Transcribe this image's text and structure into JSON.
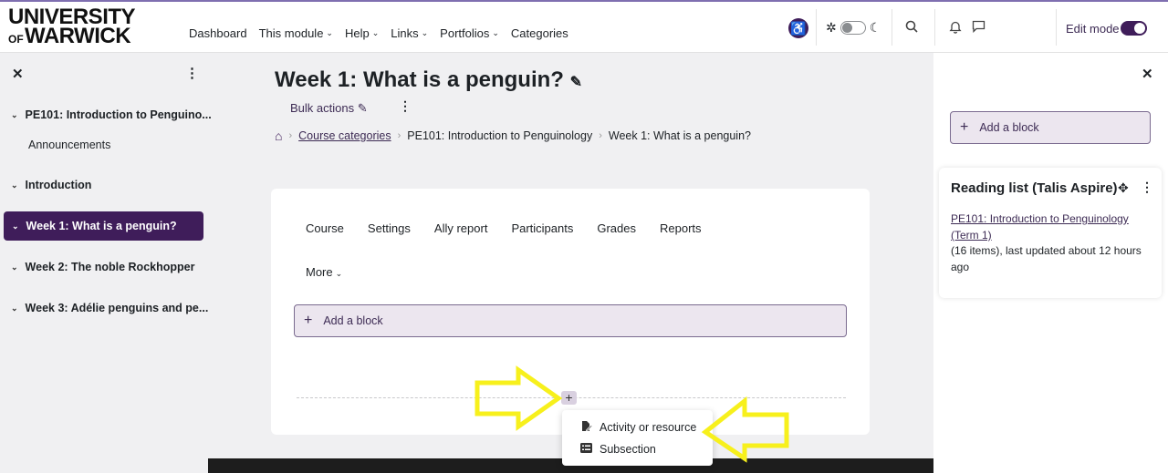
{
  "brand": {
    "line1": "UNIVERSITY",
    "of": "OF",
    "line2": "WARWICK"
  },
  "nav": {
    "items": [
      {
        "label": "Dashboard",
        "dropdown": false
      },
      {
        "label": "This module",
        "dropdown": true
      },
      {
        "label": "Help",
        "dropdown": true
      },
      {
        "label": "Links",
        "dropdown": true
      },
      {
        "label": "Portfolios",
        "dropdown": true
      },
      {
        "label": "Categories",
        "dropdown": false
      }
    ],
    "edit_mode_label": "Edit mode",
    "edit_mode_on": true,
    "dark_mode_on": false
  },
  "left_drawer": {
    "items": [
      {
        "label": "PE101: Introduction to Penguino...",
        "type": "section"
      },
      {
        "label": "Announcements",
        "type": "sub"
      },
      {
        "label": "Introduction",
        "type": "section"
      },
      {
        "label": "Week 1: What is a penguin?",
        "type": "active"
      },
      {
        "label": "Week 2: The noble Rockhopper",
        "type": "section"
      },
      {
        "label": "Week 3: Adélie penguins and pe...",
        "type": "section"
      }
    ]
  },
  "main": {
    "title": "Week 1: What is a penguin?",
    "bulk_actions": "Bulk actions",
    "breadcrumb": [
      "Course categories",
      "PE101: Introduction to Penguinology",
      "Week 1: What is a penguin?"
    ],
    "tabs": [
      "Course",
      "Settings",
      "Ally report",
      "Participants",
      "Grades",
      "Reports"
    ],
    "more_label": "More",
    "add_block": "Add a block",
    "add_menu": [
      "Activity or resource",
      "Subsection"
    ]
  },
  "right_drawer": {
    "add_block": "Add a block",
    "reading_list": {
      "title": "Reading list (Talis Aspire)",
      "link": "PE101: Introduction to Penguinology (Term 1)",
      "details": "(16 items), last updated about 12 hours ago"
    }
  },
  "colors": {
    "brand_purple": "#3f1d5a",
    "highlight_arrow": "#f7f01c"
  }
}
